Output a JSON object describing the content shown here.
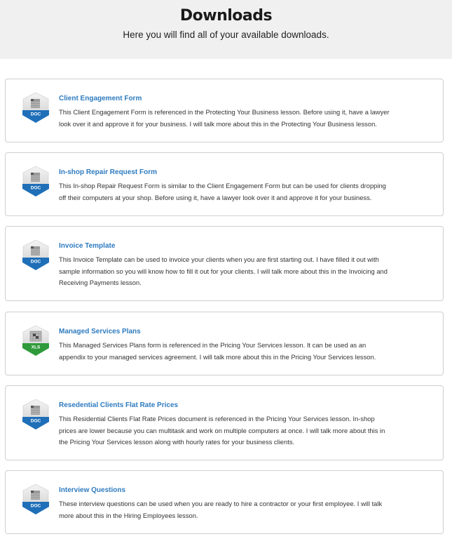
{
  "header": {
    "title": "Downloads",
    "subtitle": "Here you will find all of your available downloads."
  },
  "colors": {
    "link": "#2e7bbf",
    "doc_badge": "#1f6fb8",
    "xls_badge": "#2e9a3a",
    "hero_bg": "#f0f0f0"
  },
  "downloads": [
    {
      "title": "Client Engagement Form",
      "file_type": "DOC",
      "icon": "doc-file-icon",
      "description": "This Client Engagement Form is referenced in the Protecting Your Business lesson. Before using it, have a lawyer look over it and approve it for your business. I will talk more about this in the Protecting Your Business lesson."
    },
    {
      "title": "In-shop Repair Request Form",
      "file_type": "DOC",
      "icon": "doc-file-icon",
      "description": "This In-shop Repair Request Form is similar to the Client Engagement Form but can be used for clients dropping off their computers at your shop. Before using it, have a lawyer look over it and approve it for your business."
    },
    {
      "title": "Invoice Template",
      "file_type": "DOC",
      "icon": "doc-file-icon",
      "description": "This Invoice Template can be used to invoice your clients when you are first starting out. I have filled it out with sample information so you will know how to fill it out for your clients. I will talk more about this in the Invoicing and Receiving Payments lesson."
    },
    {
      "title": "Managed Services Plans",
      "file_type": "XLS",
      "icon": "xls-file-icon",
      "description": "This Managed Services Plans form is referenced in the Pricing Your Services lesson. It can be used as an appendix to your managed services agreement. I will talk more about this in the Pricing Your Services lesson."
    },
    {
      "title": "Resedential Clients Flat Rate Prices",
      "file_type": "DOC",
      "icon": "doc-file-icon",
      "description": "This Residential Clients Flat Rate Prices document is referenced in the Pricing Your Services lesson. In-shop prices are lower because you can multitask and work on multiple computers at once. I will talk more about this in the Pricing Your Services lesson along with hourly rates for your business clients."
    },
    {
      "title": "Interview Questions",
      "file_type": "DOC",
      "icon": "doc-file-icon",
      "description": "These interview questions can be used when you are ready to hire a contractor or your first employee. I will talk more about this in the Hiring Employees lesson."
    }
  ]
}
